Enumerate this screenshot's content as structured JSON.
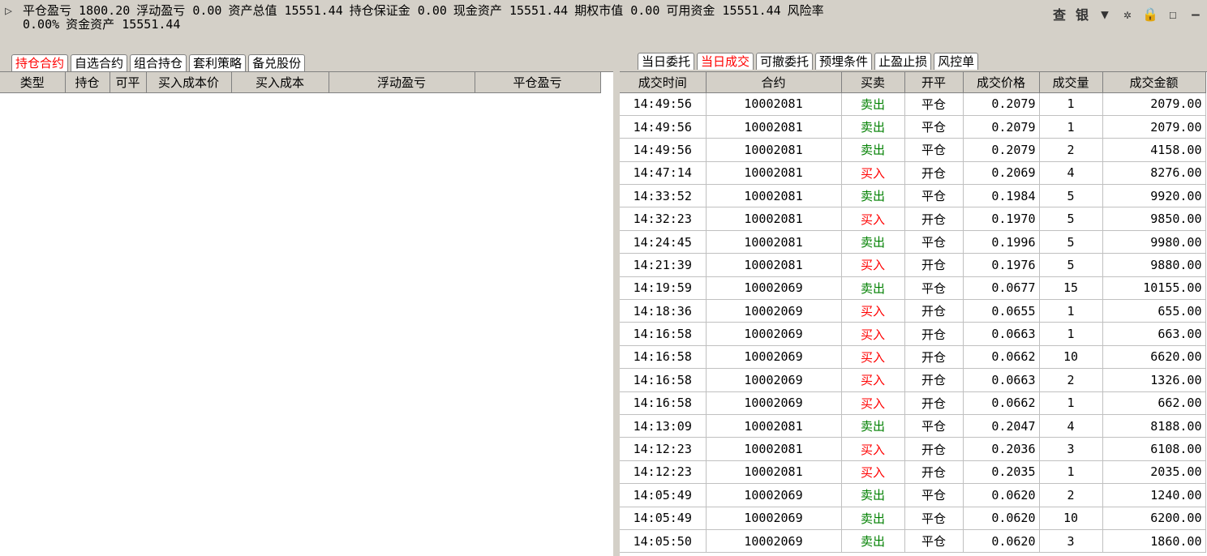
{
  "summary": {
    "arrow": "▷",
    "close_pnl_label": "平仓盈亏",
    "close_pnl": "1800.20",
    "float_pnl_label": "浮动盈亏",
    "float_pnl": "0.00",
    "total_assets_label": "资产总值",
    "total_assets": "15551.44",
    "margin_label": "持仓保证金",
    "margin": "0.00",
    "cash_label": "现金资产",
    "cash": "15551.44",
    "option_mv_label": "期权市值",
    "option_mv": "0.00",
    "available_label": "可用资金",
    "available": "15551.44",
    "risk_label": "风险率",
    "risk": "0.00%",
    "fund_assets_label": "资金资产",
    "fund_assets": "15551.44"
  },
  "toolbar": {
    "query": "查",
    "bank": "银",
    "menu_icon": "▼",
    "settings_icon": "✲",
    "lock_icon": "🔒",
    "window_icon": "☐",
    "minimize_icon": "—"
  },
  "left_tabs": [
    "持仓合约",
    "自选合约",
    "组合持仓",
    "套利策略",
    "备兑股份"
  ],
  "left_headers": [
    "类型",
    "持仓",
    "可平",
    "买入成本价",
    "买入成本",
    "浮动盈亏",
    "平仓盈亏"
  ],
  "right_tabs": [
    "当日委托",
    "当日成交",
    "可撤委托",
    "预埋条件",
    "止盈止损",
    "风控单"
  ],
  "right_headers": [
    "成交时间",
    "合约",
    "买卖",
    "开平",
    "成交价格",
    "成交量",
    "成交金额"
  ],
  "trades": [
    [
      "14:49:56",
      "10002081",
      "卖出",
      "平仓",
      "0.2079",
      "1",
      "2079.00"
    ],
    [
      "14:49:56",
      "10002081",
      "卖出",
      "平仓",
      "0.2079",
      "1",
      "2079.00"
    ],
    [
      "14:49:56",
      "10002081",
      "卖出",
      "平仓",
      "0.2079",
      "2",
      "4158.00"
    ],
    [
      "14:47:14",
      "10002081",
      "买入",
      "开仓",
      "0.2069",
      "4",
      "8276.00"
    ],
    [
      "14:33:52",
      "10002081",
      "卖出",
      "平仓",
      "0.1984",
      "5",
      "9920.00"
    ],
    [
      "14:32:23",
      "10002081",
      "买入",
      "开仓",
      "0.1970",
      "5",
      "9850.00"
    ],
    [
      "14:24:45",
      "10002081",
      "卖出",
      "平仓",
      "0.1996",
      "5",
      "9980.00"
    ],
    [
      "14:21:39",
      "10002081",
      "买入",
      "开仓",
      "0.1976",
      "5",
      "9880.00"
    ],
    [
      "14:19:59",
      "10002069",
      "卖出",
      "平仓",
      "0.0677",
      "15",
      "10155.00"
    ],
    [
      "14:18:36",
      "10002069",
      "买入",
      "开仓",
      "0.0655",
      "1",
      "655.00"
    ],
    [
      "14:16:58",
      "10002069",
      "买入",
      "开仓",
      "0.0663",
      "1",
      "663.00"
    ],
    [
      "14:16:58",
      "10002069",
      "买入",
      "开仓",
      "0.0662",
      "10",
      "6620.00"
    ],
    [
      "14:16:58",
      "10002069",
      "买入",
      "开仓",
      "0.0663",
      "2",
      "1326.00"
    ],
    [
      "14:16:58",
      "10002069",
      "买入",
      "开仓",
      "0.0662",
      "1",
      "662.00"
    ],
    [
      "14:13:09",
      "10002081",
      "卖出",
      "平仓",
      "0.2047",
      "4",
      "8188.00"
    ],
    [
      "14:12:23",
      "10002081",
      "买入",
      "开仓",
      "0.2036",
      "3",
      "6108.00"
    ],
    [
      "14:12:23",
      "10002081",
      "买入",
      "开仓",
      "0.2035",
      "1",
      "2035.00"
    ],
    [
      "14:05:49",
      "10002069",
      "卖出",
      "平仓",
      "0.0620",
      "2",
      "1240.00"
    ],
    [
      "14:05:49",
      "10002069",
      "卖出",
      "平仓",
      "0.0620",
      "10",
      "6200.00"
    ],
    [
      "14:05:50",
      "10002069",
      "卖出",
      "平仓",
      "0.0620",
      "3",
      "1860.00"
    ]
  ],
  "colors": {
    "sell": "#008000",
    "buy": "#ff0000",
    "active_tab": "#ff0000"
  }
}
